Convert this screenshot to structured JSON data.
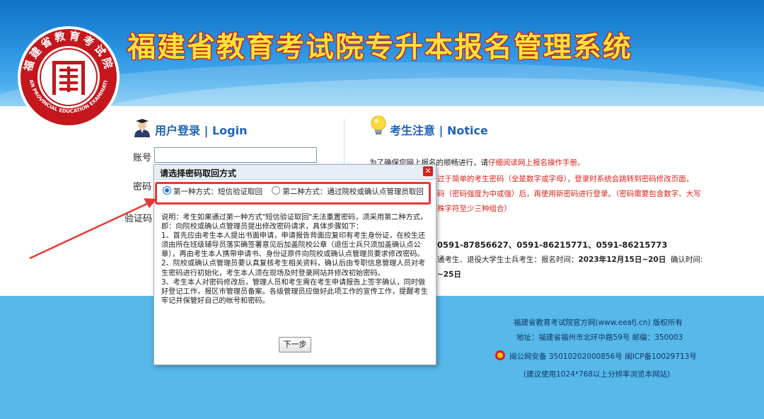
{
  "header": {
    "system_title": "福建省教育考试院专升本报名管理系统",
    "logo": {
      "ring_text": "福建省教育考试院",
      "ring_text_en": "FUJIAN PROVINCIAL EDUCATION EXAMINATIONS",
      "emblem_icon": "fujian-education-exam-emblem"
    }
  },
  "login": {
    "title": "用户登录 | Login",
    "account_label": "账号",
    "account_value": "",
    "password_label": "密码",
    "captcha_label": "验证码"
  },
  "notice": {
    "title": "考生注意 | Notice",
    "line1_black": "为了确保您网上报名的顺畅进行，请",
    "line1_red": "仔细阅读网上报名操作手册。",
    "line2": "过于简单的考生密码（全是数字或字母），登录时系统会跳转到密码修改页面，",
    "line3": "码（密码强度为中或强）后，再使用新密码进行登录。（密码需要包含数字、大写",
    "line4": "殊字符至少三种组合）",
    "phones": "0591-87856627、0591-86215771、0591-86215773",
    "line6_a": "通考生、退役大学生士兵考生：报名时间：",
    "line6_b": "2023年12月15日~20日",
    "line6_c": "确认时间:",
    "line7": "~25日"
  },
  "footer": {
    "copyright": "福建省教育考试院官方网(www.eeafj.cn) 版权所有",
    "address": "地址：福建省福州市北环中路59号 邮编：350003",
    "icp": "闽公网安备 35010202000856号  闽ICP备10029713号",
    "resolution": "(建议使用1024*768以上分辨率浏览本网站)"
  },
  "dialog": {
    "title": "请选择密码取回方式",
    "close_label": "✕",
    "options": [
      {
        "label": "第一种方式：短信验证取回",
        "selected": true
      },
      {
        "label": "第二种方式：通过院校或确认点管理员取回",
        "selected": false
      }
    ],
    "description": [
      "说明：考生如果通过第一种方式\"短信验证取回\"无法重置密码，须采用第二种方式，即：向院校或确认点管理员提出修改密码请求，具体步骤如下：",
      "1、首先应由考生本人提出书面申请，申请报告背面应复印有考生身份证，在校生还须由所在班级辅导员落实确签署意见后加盖院校公章（退伍士兵只须加盖确认点公章），再由考生本人携带申请书、身份证原件向院校或确认点管理员要求修改密码。",
      "2、院校或确认点管理员要认真复核考生相关资料，确认后由专职信息管理人员对考生密码进行初始化，考生本人须在现场及时登录网站并修改初始密码。",
      "3、考生本人对密码修改后，管理人员和考生需在考生申请报告上签字确认，同时做好登记工作，报区市管理员备案。各级管理员应做好此项工作的宣传工作，提醒考生牢记并保管好自己的帐号和密码。"
    ],
    "next_button": "下一步"
  },
  "colors": {
    "header_blue": "#1a7fd4",
    "title_yellow": "#ffe23a",
    "accent_red": "#d9211a",
    "section_blue": "#1f63b6",
    "footer_blue": "#57b8ea"
  }
}
